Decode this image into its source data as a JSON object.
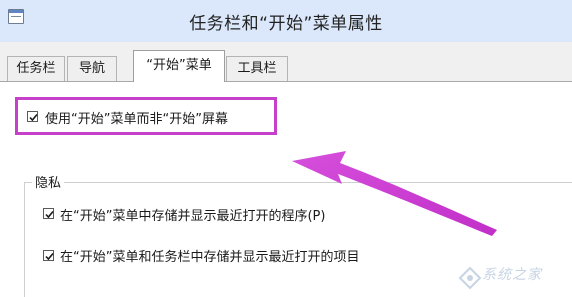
{
  "window": {
    "title": "任务栏和“开始”菜单属性"
  },
  "tabs": [
    {
      "label": "任务栏"
    },
    {
      "label": "导航"
    },
    {
      "label": "“开始”菜单"
    },
    {
      "label": "工具栏"
    }
  ],
  "start_menu": {
    "use_start_menu_label": "使用“开始”菜单而非“开始”屏幕",
    "use_start_menu_checked": true
  },
  "privacy": {
    "title": "隐私",
    "items": [
      {
        "label": "在“开始”菜单中存储并显示最近打开的程序(P)",
        "checked": true
      },
      {
        "label": "在“开始”菜单和任务栏中存储并显示最近打开的项目",
        "checked": true
      }
    ]
  },
  "watermark": {
    "text": "系统之家"
  },
  "colors": {
    "highlight": "#c541c9",
    "titlebar": "#dbe8fb"
  }
}
